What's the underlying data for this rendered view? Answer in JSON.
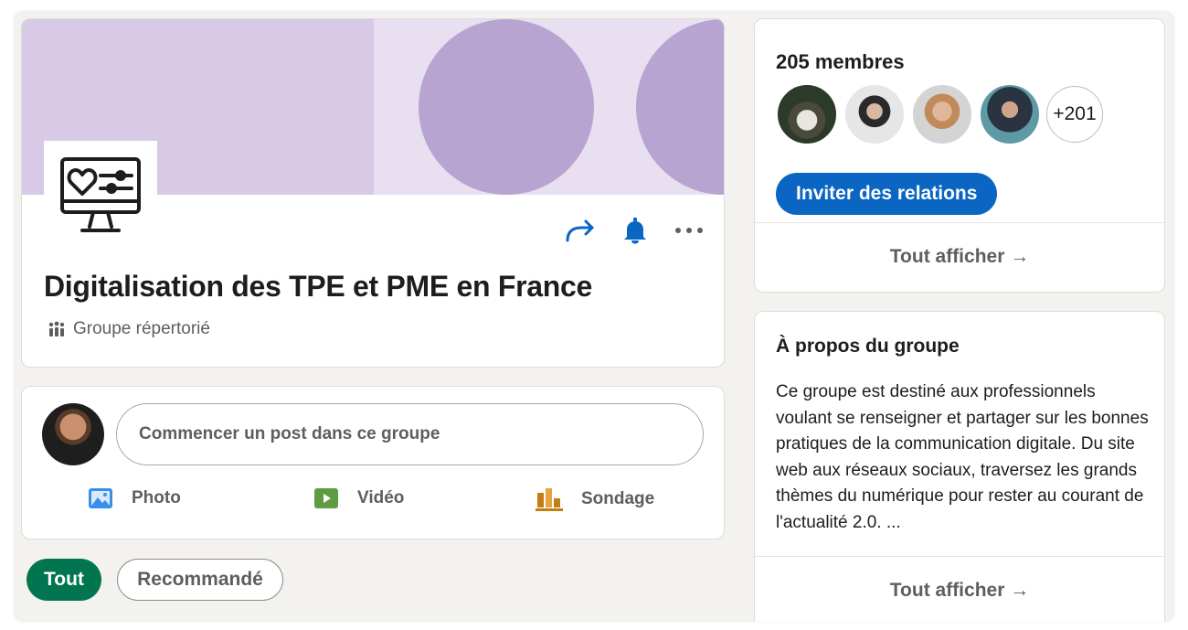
{
  "group": {
    "title": "Digitalisation des TPE et PME en France",
    "listed_label": "Groupe répertorié",
    "banner_colors": {
      "light": "#e8dff0",
      "left": "#d8c9e6",
      "circle": "#b8a4d1"
    },
    "logo_icon": "monitor-heart-sliders-icon",
    "actions": [
      "share-icon",
      "bell-icon",
      "more-icon"
    ]
  },
  "composer": {
    "placeholder": "Commencer un post dans ce groupe",
    "actions": {
      "photo": "Photo",
      "video": "Vidéo",
      "poll": "Sondage"
    }
  },
  "filters": {
    "all": "Tout",
    "recommended": "Recommandé"
  },
  "members": {
    "count_label": "205 membres",
    "more_label": "+201",
    "invite_label": "Inviter des relations",
    "show_all_label": "Tout afficher →"
  },
  "about": {
    "title": "À propos du groupe",
    "text": "Ce groupe est destiné aux professionnels voulant se renseigner et partager sur les bonnes pratiques de la communication digitale. Du site web aux réseaux sociaux, traversez les grands thèmes du numérique pour rester au courant de l'actualité 2.0. ...",
    "show_all_label": "Tout afficher →"
  },
  "colors": {
    "accent_blue": "#0a66c2",
    "chip_green": "#01754f",
    "photo_icon": "#378fe9",
    "video_icon": "#5f9b41",
    "poll_icon": "#c37d16"
  }
}
